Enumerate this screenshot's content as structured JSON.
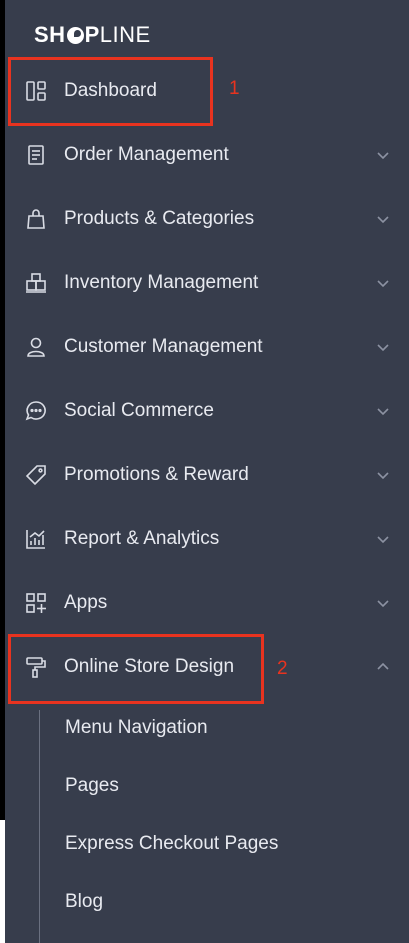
{
  "brand": {
    "logo_bold_1": "SH",
    "logo_bold_2": "P",
    "logo_light": "LINE"
  },
  "nav": {
    "items": [
      {
        "label": "Dashboard",
        "icon": "dashboard-icon",
        "has_chevron": false
      },
      {
        "label": "Order Management",
        "icon": "order-icon",
        "has_chevron": true
      },
      {
        "label": "Products & Categories",
        "icon": "bag-icon",
        "has_chevron": true
      },
      {
        "label": "Inventory Management",
        "icon": "inventory-icon",
        "has_chevron": true
      },
      {
        "label": "Customer Management",
        "icon": "user-icon",
        "has_chevron": true
      },
      {
        "label": "Social Commerce",
        "icon": "chat-icon",
        "has_chevron": true
      },
      {
        "label": "Promotions & Reward",
        "icon": "tag-icon",
        "has_chevron": true
      },
      {
        "label": "Report & Analytics",
        "icon": "chart-icon",
        "has_chevron": true
      },
      {
        "label": "Apps",
        "icon": "apps-icon",
        "has_chevron": true
      },
      {
        "label": "Online Store Design",
        "icon": "paint-roller-icon",
        "has_chevron": true,
        "expanded": true
      }
    ],
    "submenu": [
      "Menu Navigation",
      "Pages",
      "Express Checkout Pages",
      "Blog"
    ]
  },
  "annotations": {
    "one": "1",
    "two": "2"
  },
  "colors": {
    "sidebar_bg": "#373d4c",
    "text": "#e8eaf0",
    "annotation_red": "#e8331f"
  }
}
